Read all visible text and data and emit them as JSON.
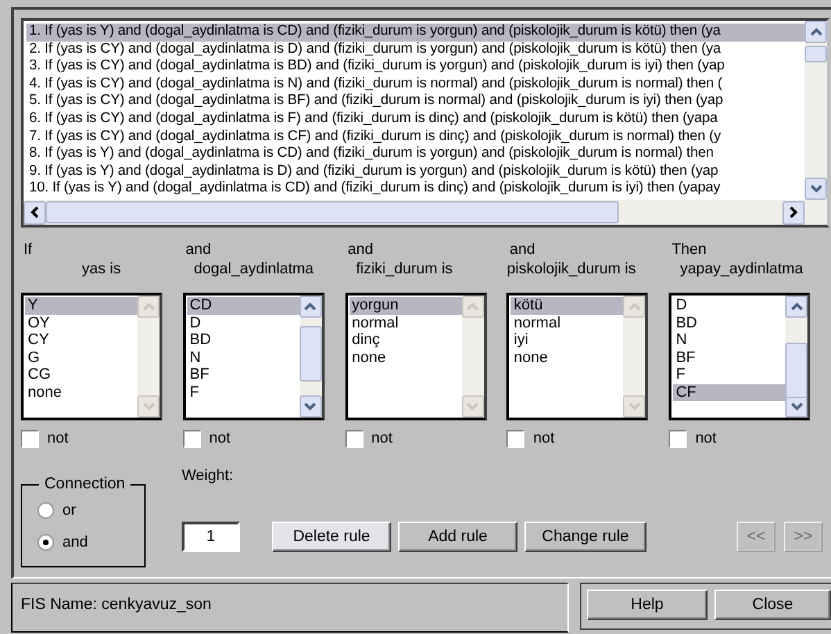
{
  "rules": [
    {
      "text": "1. If (yas is Y) and (dogal_aydinlatma is CD) and (fiziki_durum is yorgun) and (piskolojik_durum is kötü) then (ya",
      "selected": true
    },
    {
      "text": "2. If (yas is CY) and (dogal_aydinlatma is D) and (fiziki_durum is yorgun) and (piskolojik_durum is kötü) then (ya",
      "selected": false
    },
    {
      "text": "3. If (yas is CY) and (dogal_aydinlatma is BD) and (fiziki_durum is yorgun) and (piskolojik_durum is iyi) then (yap",
      "selected": false
    },
    {
      "text": "4. If (yas is CY) and (dogal_aydinlatma is N) and (fiziki_durum is normal) and (piskolojik_durum is normal) then (",
      "selected": false
    },
    {
      "text": "5. If (yas is CY) and (dogal_aydinlatma is BF) and (fiziki_durum is normal) and (piskolojik_durum is iyi) then (yap",
      "selected": false
    },
    {
      "text": "6. If (yas is CY) and (dogal_aydinlatma is F) and (fiziki_durum is dinç) and (piskolojik_durum is kötü) then (yapa",
      "selected": false
    },
    {
      "text": "7. If (yas is CY) and (dogal_aydinlatma is CF) and (fiziki_durum is dinç) and (piskolojik_durum is normal) then (y",
      "selected": false
    },
    {
      "text": "8. If (yas is Y) and (dogal_aydinlatma is CD) and (fiziki_durum is yorgun) and (piskolojik_durum is normal) then",
      "selected": false
    },
    {
      "text": "9. If (yas is Y) and (dogal_aydinlatma is D) and (fiziki_durum is yorgun) and (piskolojik_durum is kötü) then (yap",
      "selected": false
    },
    {
      "text": "10. If (yas is Y) and (dogal_aydinlatma is CD) and (fiziki_durum is dinç) and (piskolojik_durum is iyi) then (yapay",
      "selected": false
    }
  ],
  "columns": [
    {
      "connector": "If",
      "variable": "yas is",
      "scrollable": false,
      "not": false,
      "not_label": "not",
      "items": [
        {
          "label": "Y",
          "selected": true
        },
        {
          "label": "OY",
          "selected": false
        },
        {
          "label": "CY",
          "selected": false
        },
        {
          "label": "G",
          "selected": false
        },
        {
          "label": "CG",
          "selected": false
        },
        {
          "label": "none",
          "selected": false
        }
      ]
    },
    {
      "connector": "and",
      "variable": "dogal_aydinlatma",
      "scrollable": true,
      "not": false,
      "not_label": "not",
      "items": [
        {
          "label": "CD",
          "selected": true
        },
        {
          "label": "D",
          "selected": false
        },
        {
          "label": "BD",
          "selected": false
        },
        {
          "label": "N",
          "selected": false
        },
        {
          "label": "BF",
          "selected": false
        },
        {
          "label": "F",
          "selected": false
        }
      ]
    },
    {
      "connector": "and",
      "variable": "fiziki_durum is",
      "scrollable": false,
      "not": false,
      "not_label": "not",
      "items": [
        {
          "label": "yorgun",
          "selected": true
        },
        {
          "label": "normal",
          "selected": false
        },
        {
          "label": "dinç",
          "selected": false
        },
        {
          "label": "none",
          "selected": false
        }
      ]
    },
    {
      "connector": "and",
      "variable": "piskolojik_durum is",
      "scrollable": false,
      "not": false,
      "not_label": "not",
      "items": [
        {
          "label": "kötü",
          "selected": true
        },
        {
          "label": "normal",
          "selected": false
        },
        {
          "label": "iyi",
          "selected": false
        },
        {
          "label": "none",
          "selected": false
        }
      ]
    },
    {
      "connector": "Then",
      "variable": "yapay_aydinlatma",
      "scrollable": true,
      "not": false,
      "not_label": "not",
      "items": [
        {
          "label": "D",
          "selected": false
        },
        {
          "label": "BD",
          "selected": false
        },
        {
          "label": "N",
          "selected": false
        },
        {
          "label": "BF",
          "selected": false
        },
        {
          "label": "F",
          "selected": false
        },
        {
          "label": "CF",
          "selected": true
        }
      ]
    }
  ],
  "connection": {
    "label": "Connection",
    "options": [
      {
        "label": "or",
        "selected": false
      },
      {
        "label": "and",
        "selected": true
      }
    ]
  },
  "weight": {
    "label": "Weight:",
    "value": "1"
  },
  "buttons": [
    {
      "label": "Delete rule",
      "focused": true
    },
    {
      "label": "Add rule",
      "focused": false
    },
    {
      "label": "Change rule",
      "focused": false
    }
  ],
  "nav_buttons": [
    {
      "label": "<<",
      "disabled": true
    },
    {
      "label": ">>",
      "disabled": true
    }
  ],
  "status": "FIS Name: cenkyavuz_son",
  "footer_buttons": [
    "Help",
    "Close"
  ]
}
